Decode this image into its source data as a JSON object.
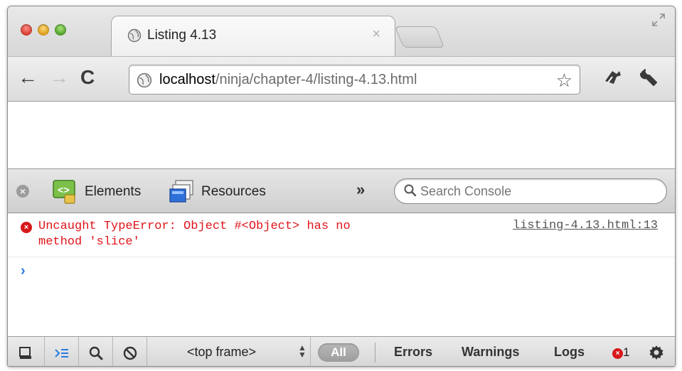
{
  "tab": {
    "title": "Listing 4.13",
    "close_glyph": "×"
  },
  "toolbar": {
    "back_glyph": "←",
    "forward_glyph": "→",
    "reload_glyph": "C",
    "url_host": "localhost",
    "url_path": "/ninja/chapter-4/listing-4.13.html",
    "star_glyph": "☆"
  },
  "devtools": {
    "close_glyph": "×",
    "panels": [
      {
        "label": "Elements",
        "icon": "elements-panel-icon"
      },
      {
        "label": "Resources",
        "icon": "resources-panel-icon"
      }
    ],
    "more_glyph": "»",
    "search_placeholder": "Search Console"
  },
  "console": {
    "error_icon_glyph": "×",
    "error_message": "Uncaught TypeError: Object #<Object> has no\nmethod 'slice'",
    "error_source": "listing-4.13.html:13",
    "prompt_glyph": "›"
  },
  "statusbar": {
    "frame_label": "<top frame>",
    "frame_arrows": "▲\n▼",
    "filter_all": "All",
    "filters": [
      "Errors",
      "Warnings",
      "Logs"
    ],
    "error_count": "1",
    "error_dot_glyph": "×"
  },
  "colors": {
    "error_red": "#e0141a",
    "prompt_blue": "#2a7ae2"
  }
}
